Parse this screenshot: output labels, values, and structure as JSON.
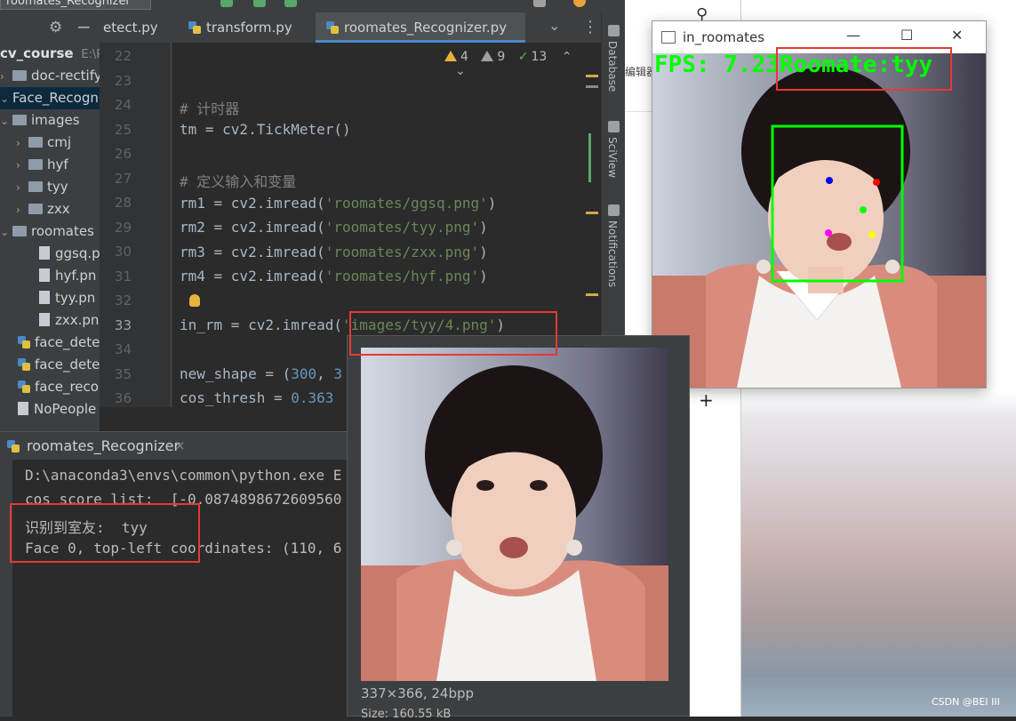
{
  "top": {
    "run_config_title": "roomates_Recognizer"
  },
  "tabs": [
    {
      "label": "etect.py",
      "active": false
    },
    {
      "label": "transform.py",
      "active": false
    },
    {
      "label": "roomates_Recognizer.py",
      "active": true
    }
  ],
  "inspections": {
    "warnings": "4",
    "weak_warnings": "9",
    "ok": "13"
  },
  "project_tree": [
    {
      "label": "cv_course",
      "suffix": "E:\\Py",
      "indent": 0,
      "kind": "root"
    },
    {
      "label": "doc-rectify-c",
      "indent": 1,
      "kind": "folder"
    },
    {
      "label": "Face_Recogn",
      "indent": 1,
      "kind": "folder",
      "selected": true
    },
    {
      "label": "images",
      "indent": 1,
      "kind": "folder"
    },
    {
      "label": "cmj",
      "indent": 2,
      "kind": "folder"
    },
    {
      "label": "hyf",
      "indent": 2,
      "kind": "folder"
    },
    {
      "label": "tyy",
      "indent": 2,
      "kind": "folder"
    },
    {
      "label": "zxx",
      "indent": 2,
      "kind": "folder"
    },
    {
      "label": "roomates",
      "indent": 1,
      "kind": "folder"
    },
    {
      "label": "ggsq.p",
      "indent": 3,
      "kind": "file"
    },
    {
      "label": "hyf.pn",
      "indent": 3,
      "kind": "file"
    },
    {
      "label": "tyy.pn",
      "indent": 3,
      "kind": "file"
    },
    {
      "label": "zxx.pn",
      "indent": 3,
      "kind": "file"
    },
    {
      "label": "face_dete",
      "indent": 1,
      "kind": "py"
    },
    {
      "label": "face_dete",
      "indent": 1,
      "kind": "py"
    },
    {
      "label": "face_reco",
      "indent": 1,
      "kind": "py"
    },
    {
      "label": "NoPeople",
      "indent": 1,
      "kind": "file"
    }
  ],
  "code": [
    {
      "n": "22",
      "t": ""
    },
    {
      "n": "23",
      "t": ""
    },
    {
      "n": "24",
      "t": "# 计时器"
    },
    {
      "n": "25",
      "t": "tm = cv2.TickMeter()"
    },
    {
      "n": "26",
      "t": ""
    },
    {
      "n": "27",
      "t": "# 定义输入和变量"
    },
    {
      "n": "28",
      "t": "rm1 = cv2.imread('roomates/ggsq.png')"
    },
    {
      "n": "29",
      "t": "rm2 = cv2.imread('roomates/tyy.png')"
    },
    {
      "n": "30",
      "t": "rm3 = cv2.imread('roomates/zxx.png')"
    },
    {
      "n": "31",
      "t": "rm4 = cv2.imread('roomates/hyf.png')"
    },
    {
      "n": "32",
      "t": ""
    },
    {
      "n": "33",
      "t": "in_rm = cv2.imread('images/tyy/4.png')"
    },
    {
      "n": "34",
      "t": ""
    },
    {
      "n": "35",
      "t": "new_shape = (300, 3"
    },
    {
      "n": "36",
      "t": "cos_thresh = 0.363"
    }
  ],
  "side_tools": [
    "Database",
    "SciView",
    "Notifications"
  ],
  "run": {
    "tab_label": "roomates_Recognizer",
    "lines": [
      "D:\\anaconda3\\envs\\common\\python.exe E",
      "cos score list:  [-0.0874898672609560",
      "识别到室友:  tyy",
      "Face 0, top-left coordinates: (110, 6"
    ]
  },
  "cv_window": {
    "title": "in_roomates",
    "overlay_fps": "FPS:  7.23",
    "overlay_roomate": "Roomate:tyy"
  },
  "popup": {
    "dims": "337×366, 24bpp",
    "size": "Size: 160.55 kB"
  },
  "desktop": {
    "note": "编辑器"
  },
  "watermark": "CSDN @BEI III",
  "colors": {
    "overlay_green": "#00ff00",
    "highlight_red": "#e53935",
    "accent_blue": "#4a88c7"
  }
}
